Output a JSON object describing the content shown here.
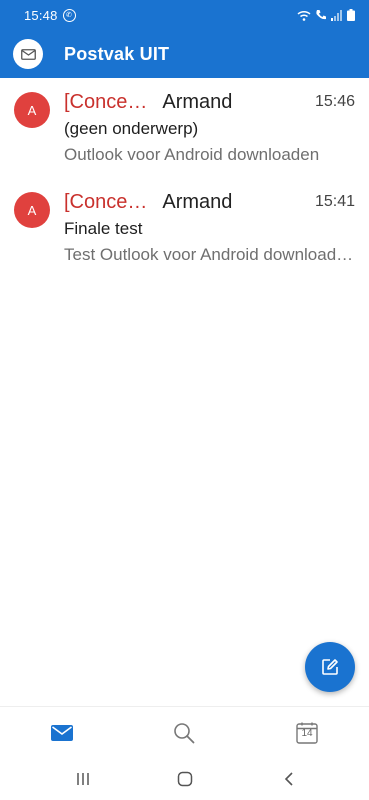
{
  "status_bar": {
    "time": "15:48"
  },
  "app_bar": {
    "title": "Postvak UIT"
  },
  "messages": [
    {
      "avatar_initial": "A",
      "tag": "[Conce…",
      "sender": "Armand",
      "time": "15:46",
      "subject": "(geen onderwerp)",
      "preview": "Outlook voor Android downloaden"
    },
    {
      "avatar_initial": "A",
      "tag": "[Conce…",
      "sender": "Armand",
      "time": "15:41",
      "subject": "Finale test",
      "preview": "Test Outlook voor Android downloaden"
    }
  ],
  "bottom_nav": {
    "calendar_day": "14"
  },
  "colors": {
    "brand": "#1a73d0",
    "avatar": "#e0413e",
    "draft_tag": "#c9312d"
  }
}
